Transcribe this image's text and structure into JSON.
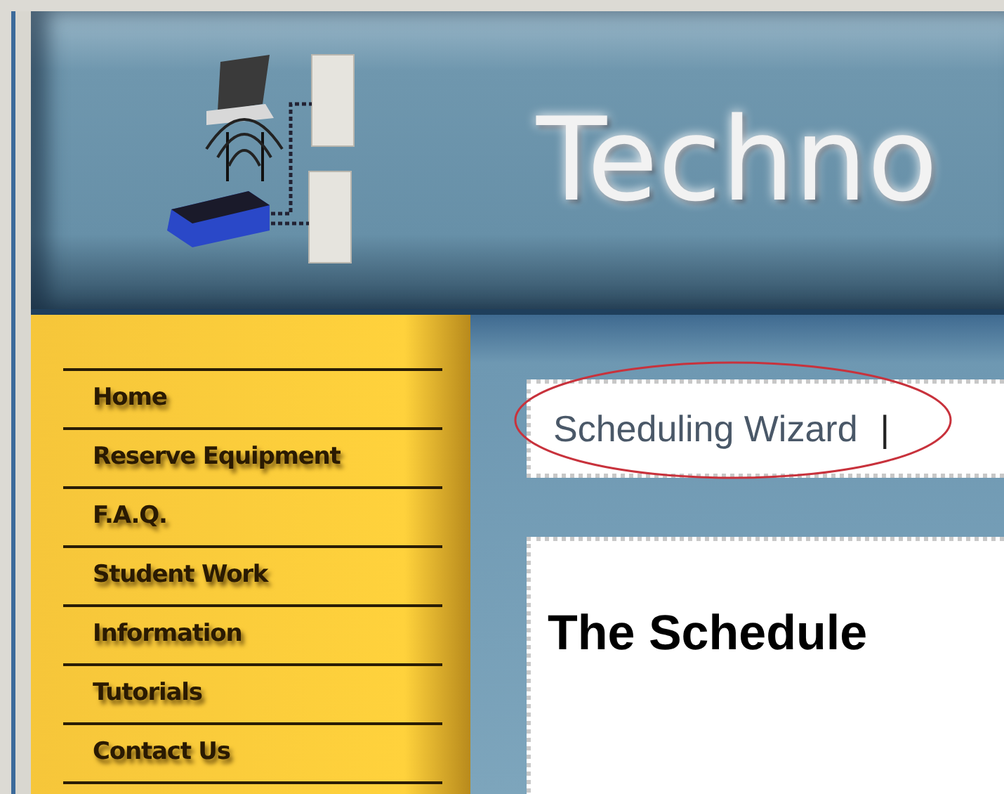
{
  "header": {
    "title": "Techno"
  },
  "nav": {
    "items": [
      {
        "label": "Home"
      },
      {
        "label": "Reserve Equipment"
      },
      {
        "label": "F.A.Q."
      },
      {
        "label": "Student Work"
      },
      {
        "label": "Information"
      },
      {
        "label": "Tutorials"
      },
      {
        "label": "Contact Us"
      }
    ]
  },
  "tabs": {
    "items": [
      {
        "label": "Scheduling Wizard"
      }
    ],
    "separator": "|"
  },
  "content": {
    "heading": "The Schedule"
  }
}
